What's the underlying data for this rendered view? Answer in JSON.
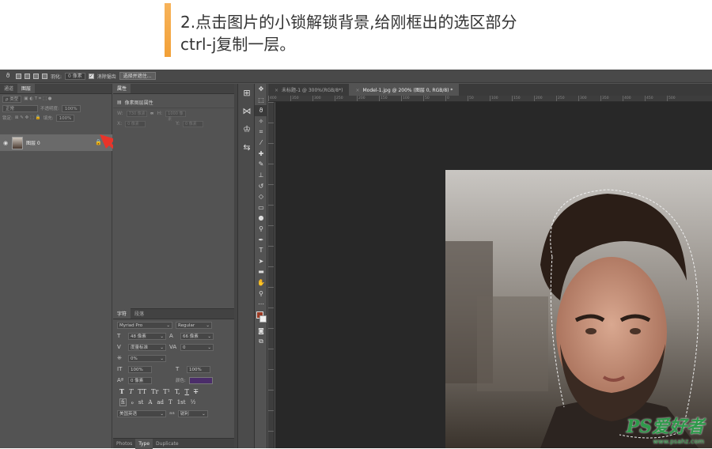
{
  "caption": {
    "line1": "2.点击图片的小锁解锁背景,给刚框出的选区部分",
    "line2": "ctrl-j复制一层。"
  },
  "options_bar": {
    "feather_label": "羽化:",
    "feather_value": "0 像素",
    "antialias_label": "消除锯齿",
    "select_mask_button": "选择并遮住..."
  },
  "layers_panel": {
    "tabs": [
      "通道",
      "图层"
    ],
    "filter_kind": "ρ 类型",
    "blend_mode": "正常",
    "opacity_label": "不透明度:",
    "opacity_value": "100%",
    "lock_label": "锁定:",
    "fill_label": "填充:",
    "fill_value": "100%",
    "layer_name": "图层 0"
  },
  "properties_panel": {
    "tab": "属性",
    "heading": "像素图层属性",
    "w_label": "W:",
    "w_value": "730 像素",
    "h_label": "H:",
    "h_value": "1000 像素",
    "x_label": "X:",
    "x_value": "0 像素",
    "y_label": "Y:",
    "y_value": "0 像素"
  },
  "character_panel": {
    "tabs": [
      "字符",
      "段落"
    ],
    "font_family": "Myriad Pro",
    "font_style": "Regular",
    "font_size": "48 像素",
    "leading": "66 像素",
    "kerning": "度量标准",
    "tracking": "0",
    "scale_pct": "0%",
    "vertical_scale": "100%",
    "horizontal_scale": "100%",
    "baseline_shift": "0 像素",
    "color_label": "颜色:",
    "language": "美国英语",
    "antialias": "锐利",
    "aa_prefix": "aa",
    "type_buttons": [
      "T",
      "T",
      "TT",
      "Tr",
      "T¹",
      "T,",
      "T",
      "T"
    ],
    "opentype_buttons": [
      "fi",
      "ℴ",
      "st",
      "A",
      "ad",
      "T",
      "1st",
      "½"
    ],
    "bottom_tabs": [
      "Photos",
      "Type",
      "Duplicate"
    ],
    "text_color": "#4b2d6a"
  },
  "document_tabs": [
    {
      "label": "未标题-1 @ 300%(RGB/8*)",
      "active": false
    },
    {
      "label": "Model-1.jpg @ 200% (图层 0, RGB/8) *",
      "active": true
    }
  ],
  "ruler_ticks": [
    "400",
    "350",
    "300",
    "250",
    "200",
    "150",
    "100",
    "50",
    "0",
    "50",
    "100",
    "150",
    "200",
    "250",
    "300",
    "350",
    "400",
    "450",
    "500"
  ],
  "watermark": {
    "brand": "PS爱好者",
    "url": "www.psahz.com"
  },
  "colors": {
    "accent": "#f2a037",
    "foreground": "#9b3b25",
    "annotation_arrow": "#e8342a"
  }
}
